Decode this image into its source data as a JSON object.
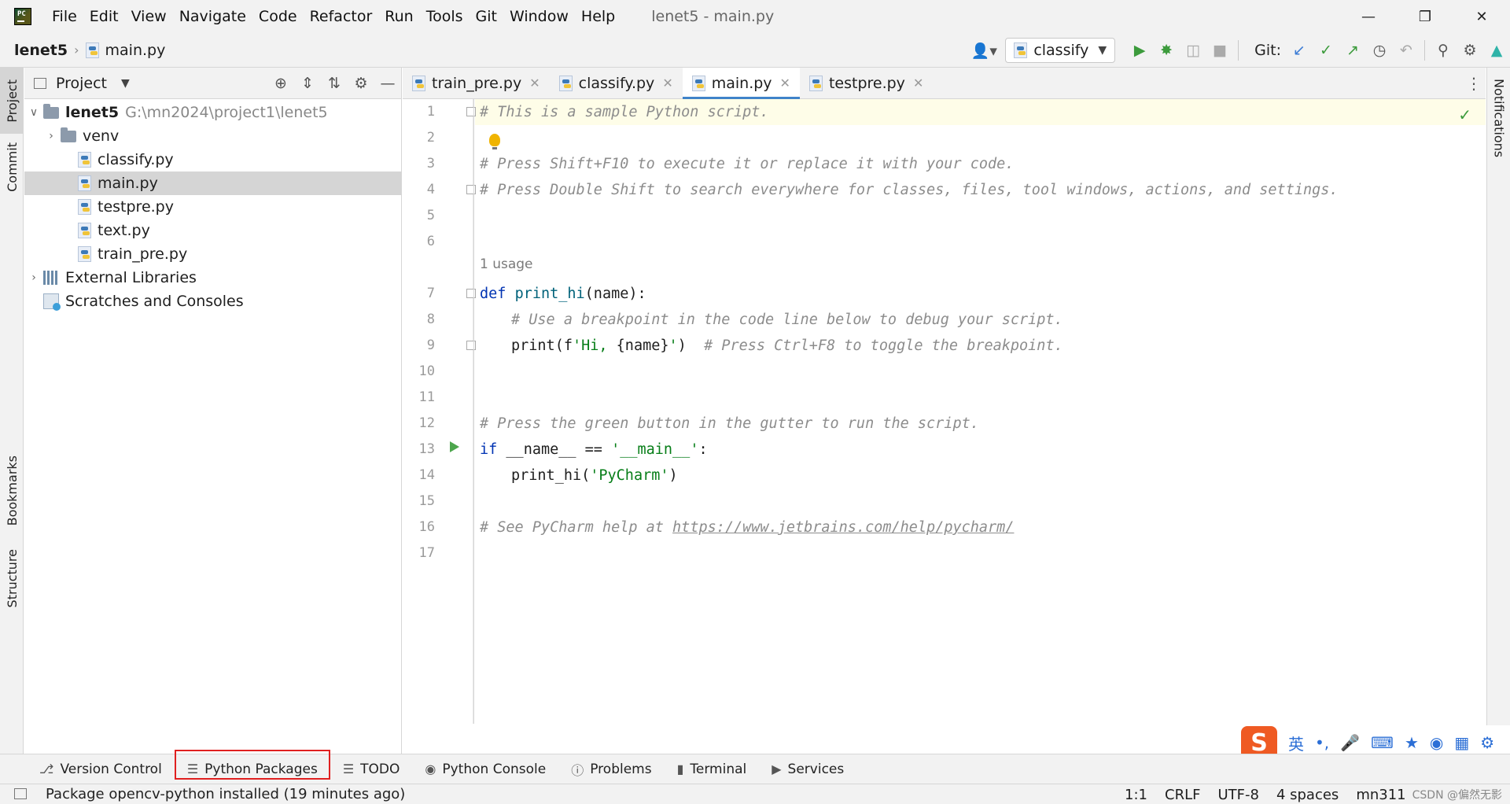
{
  "menu": {
    "items": [
      "File",
      "Edit",
      "View",
      "Navigate",
      "Code",
      "Refactor",
      "Run",
      "Tools",
      "Git",
      "Window",
      "Help"
    ],
    "mnemonics": [
      "F",
      "E",
      "V",
      "N",
      "C",
      "R",
      "R",
      "T",
      "G",
      "W",
      "H"
    ]
  },
  "window_title": "lenet5 - main.py",
  "breadcrumb": {
    "project": "lenet5",
    "file": "main.py"
  },
  "toolbar": {
    "run_config": "classify",
    "git_label": "Git:"
  },
  "left_tools": {
    "project": "Project",
    "commit": "Commit",
    "bookmarks": "Bookmarks",
    "structure": "Structure"
  },
  "right_tools": {
    "notifications": "Notifications"
  },
  "project_panel": {
    "title": "Project",
    "root_name": "lenet5",
    "root_path": "G:\\mn2024\\project1\\lenet5",
    "venv": "venv",
    "files": [
      "classify.py",
      "main.py",
      "testpre.py",
      "text.py",
      "train_pre.py"
    ],
    "external_libraries": "External Libraries",
    "scratches": "Scratches and Consoles"
  },
  "tabs": [
    "train_pre.py",
    "classify.py",
    "main.py",
    "testpre.py"
  ],
  "editor": {
    "line_numbers": [
      "1",
      "2",
      "3",
      "4",
      "5",
      "6",
      "7",
      "8",
      "9",
      "10",
      "11",
      "12",
      "13",
      "14",
      "15",
      "16",
      "17"
    ],
    "usage_hint": "1 usage",
    "lines": {
      "l1": "# This is a sample Python script.",
      "l3": "# Press Shift+F10 to execute it or replace it with your code.",
      "l4": "# Press Double Shift to search everywhere for classes, files, tool windows, actions, and settings.",
      "l7_kw": "def ",
      "l7_fn": "print_hi",
      "l7_rest": "(name):",
      "l8": "# Use a breakpoint in the code line below to debug your script.",
      "l9_code_a": "print(f",
      "l9_str_a": "'Hi, ",
      "l9_code_b": "{name}",
      "l9_str_b": "'",
      "l9_code_c": ")  ",
      "l9_cmt": "# Press Ctrl+F8 to toggle the breakpoint.",
      "l12": "# Press the green button in the gutter to run the script.",
      "l13_kw": "if ",
      "l13_code": "__name__ == ",
      "l13_str": "'__main__'",
      "l13_end": ":",
      "l14_code": "print_hi(",
      "l14_str": "'PyCharm'",
      "l14_end": ")",
      "l16_cmt": "# See PyCharm help at ",
      "l16_url": "https://www.jetbrains.com/help/pycharm/"
    }
  },
  "bottom_tabs": [
    "Version Control",
    "Python Packages",
    "TODO",
    "Python Console",
    "Problems",
    "Terminal",
    "Services"
  ],
  "status": {
    "message": "Package opencv-python installed (19 minutes ago)",
    "position": "1:1",
    "line_sep": "CRLF",
    "encoding": "UTF-8",
    "indent": "4 spaces",
    "interpreter": "mn311"
  },
  "ime": {
    "logo": "S",
    "lang": "英",
    "punct": "•,",
    "watermark": "CSDN @偏然无影"
  },
  "colors": {
    "accent": "#4083c9",
    "keyword": "#0033b3",
    "string": "#067d17",
    "comment": "#8c8c8c",
    "highlight_box": "#e02020"
  }
}
